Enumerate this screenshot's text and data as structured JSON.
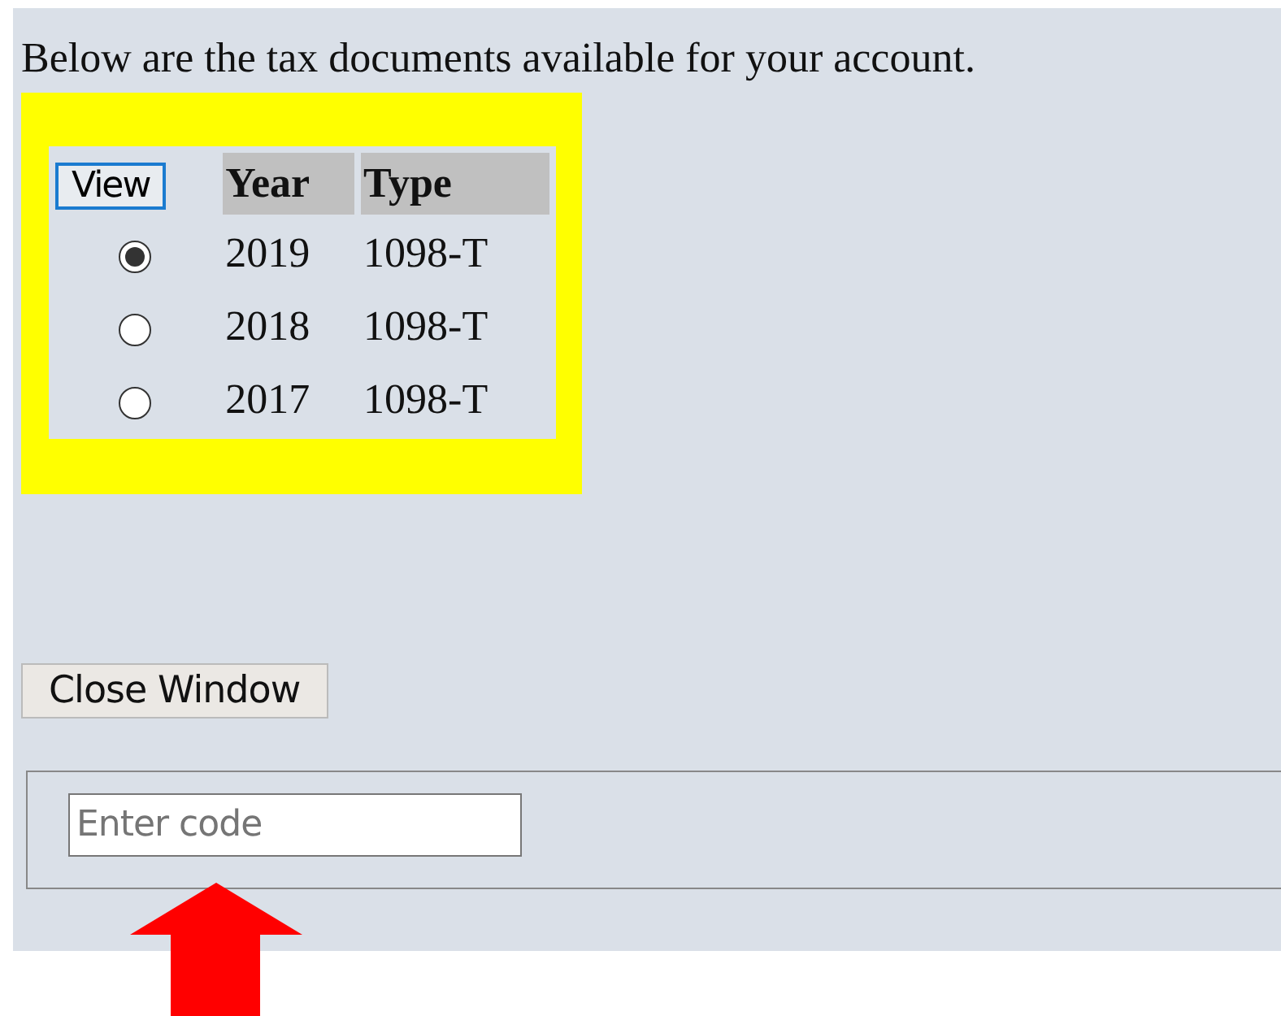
{
  "intro": "Below are the tax documents available for your account.",
  "table": {
    "view_button": "View",
    "columns": [
      "Year",
      "Type"
    ],
    "rows": [
      {
        "selected": true,
        "year": "2019",
        "type": "1098-T"
      },
      {
        "selected": false,
        "year": "2018",
        "type": "1098-T"
      },
      {
        "selected": false,
        "year": "2017",
        "type": "1098-T"
      }
    ]
  },
  "close_button": "Close Window",
  "code_field": {
    "placeholder": "Enter code"
  }
}
